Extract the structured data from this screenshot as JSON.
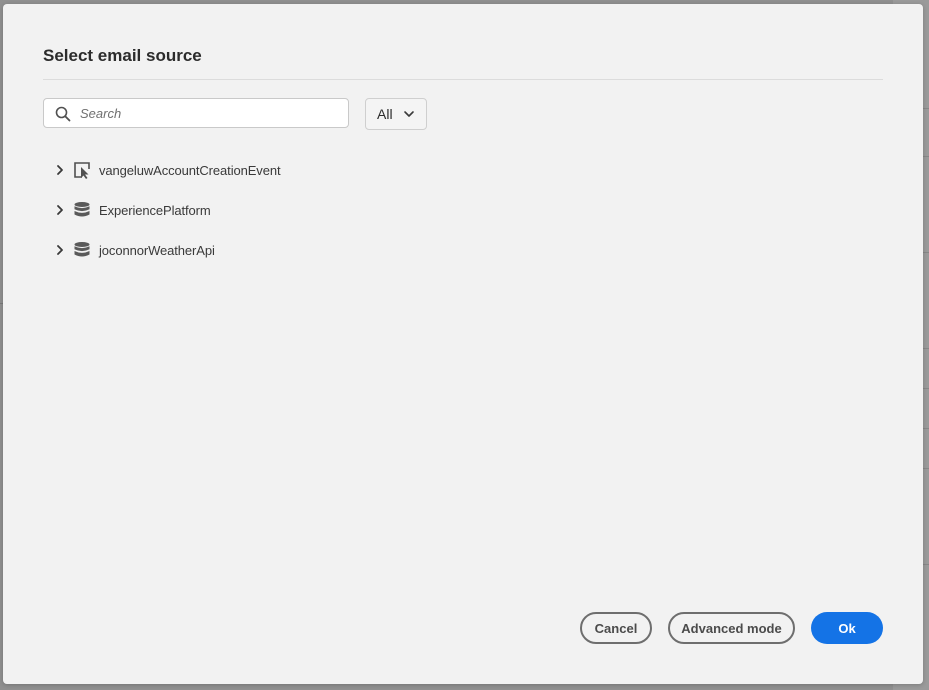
{
  "dialog": {
    "title": "Select email source"
  },
  "search": {
    "placeholder": "Search",
    "value": ""
  },
  "filter": {
    "selected": "All"
  },
  "tree": {
    "items": [
      {
        "label": "vangeluwAccountCreationEvent",
        "icon": "event-icon"
      },
      {
        "label": "ExperiencePlatform",
        "icon": "database-icon"
      },
      {
        "label": "joconnorWeatherApi",
        "icon": "database-icon"
      }
    ]
  },
  "buttons": {
    "cancel": "Cancel",
    "advanced": "Advanced mode",
    "ok": "Ok"
  },
  "colors": {
    "primary": "#1473e6",
    "dialog_bg": "#f2f2f2",
    "backdrop": "#909090"
  }
}
